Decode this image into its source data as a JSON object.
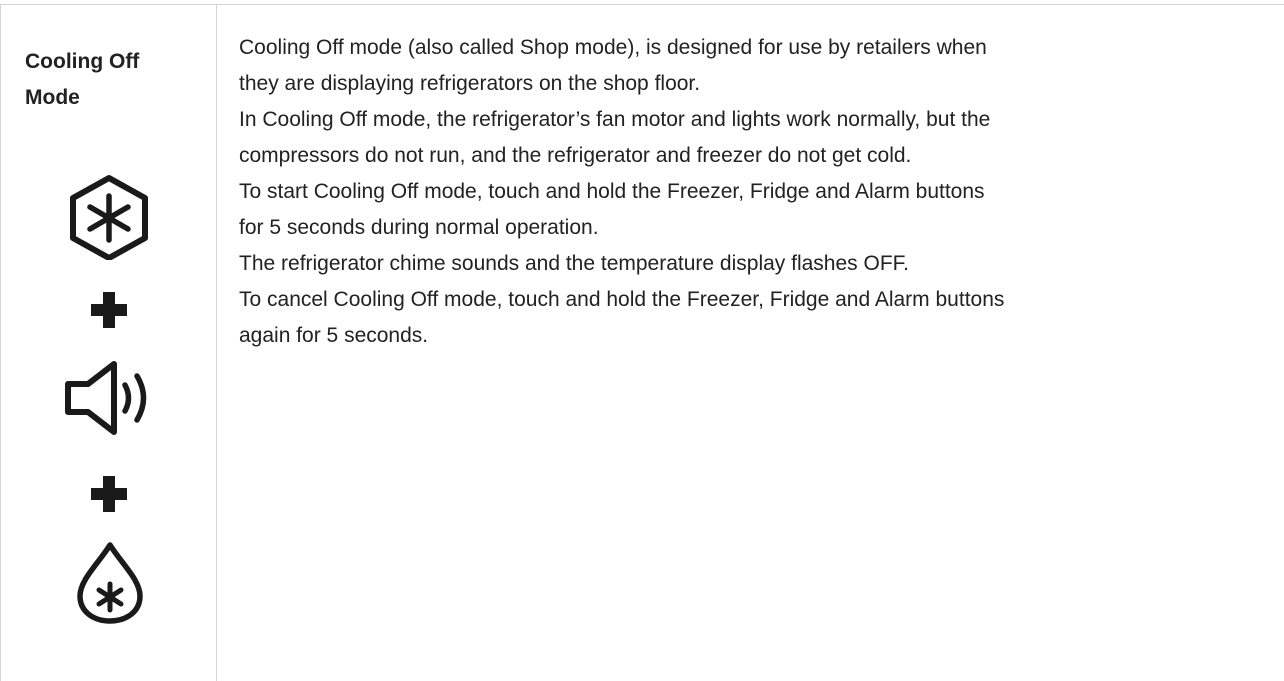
{
  "row": {
    "label": [
      "Cooling Off",
      "Mode"
    ],
    "lines": [
      "Cooling Off mode (also called Shop mode), is designed for use by retailers when",
      "they are displaying refrigerators on the shop floor.",
      "In Cooling Off mode, the refrigerator’s fan motor and lights work normally, but the",
      "compressors do not run, and the refrigerator and freezer do not get cold.",
      "To start Cooling Off mode, touch and hold the Freezer, Fridge and Alarm buttons",
      "for 5 seconds during normal operation.",
      "The refrigerator chime sounds and the temperature display flashes OFF.",
      "To cancel Cooling Off mode, touch and hold the Freezer, Fridge and Alarm buttons",
      "again for 5 seconds."
    ],
    "icons": [
      "freezer-icon",
      "plus-icon",
      "alarm-speaker-icon",
      "plus-icon",
      "fridge-drop-icon"
    ]
  },
  "colors": {
    "border": "#d4d4d4",
    "text": "#222222",
    "icon": "#1a1a1a"
  }
}
